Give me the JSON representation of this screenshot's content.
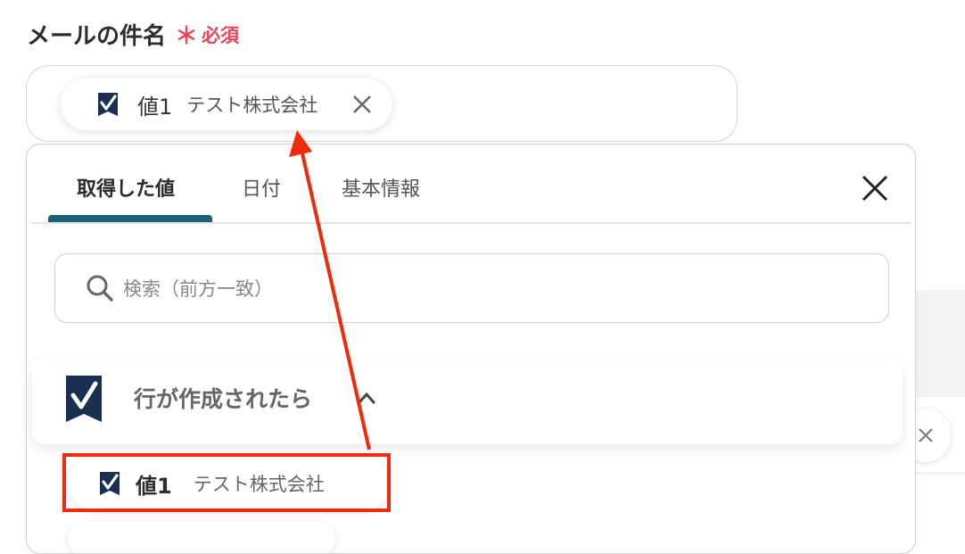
{
  "form": {
    "field_label": "メールの件名",
    "required_mark": "＊",
    "required_text": "必須",
    "chip": {
      "value_label": "値1",
      "name": "テスト株式会社"
    }
  },
  "popup": {
    "tabs": [
      {
        "label": "取得した値",
        "active": true
      },
      {
        "label": "日付",
        "active": false
      },
      {
        "label": "基本情報",
        "active": false
      }
    ],
    "search_placeholder": "検索（前方一致）",
    "group": {
      "title": "行が作成されたら",
      "expanded": true
    },
    "items": [
      {
        "value_label": "値1",
        "name": "テスト株式会社"
      }
    ]
  },
  "colors": {
    "required": "#e8465a",
    "tab_underline": "#1a6078",
    "logo": "#1b2f52",
    "annotation": "#ef2b0b"
  },
  "icons": [
    "smartsheet-logo-icon",
    "close-icon",
    "search-icon",
    "chevron-up-icon"
  ]
}
